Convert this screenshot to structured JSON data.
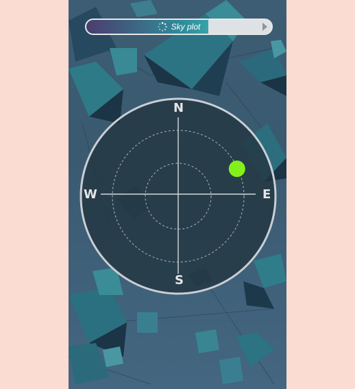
{
  "title_bar": {
    "label": "Sky plot",
    "progress": 0.66,
    "spinner_icon": "loading-spinner-icon",
    "play_icon": "play-arrow-icon"
  },
  "compass": {
    "north": "N",
    "south": "S",
    "east": "E",
    "west": "W"
  },
  "satellites": [
    {
      "azimuth_deg": 65,
      "elevation_deg": 30,
      "color": "#84f01a"
    }
  ],
  "colors": {
    "page_background": "#fbdcd2",
    "app_background": "#3c5d73",
    "satellite": "#84f01a",
    "ring": "#c9cfd4"
  }
}
